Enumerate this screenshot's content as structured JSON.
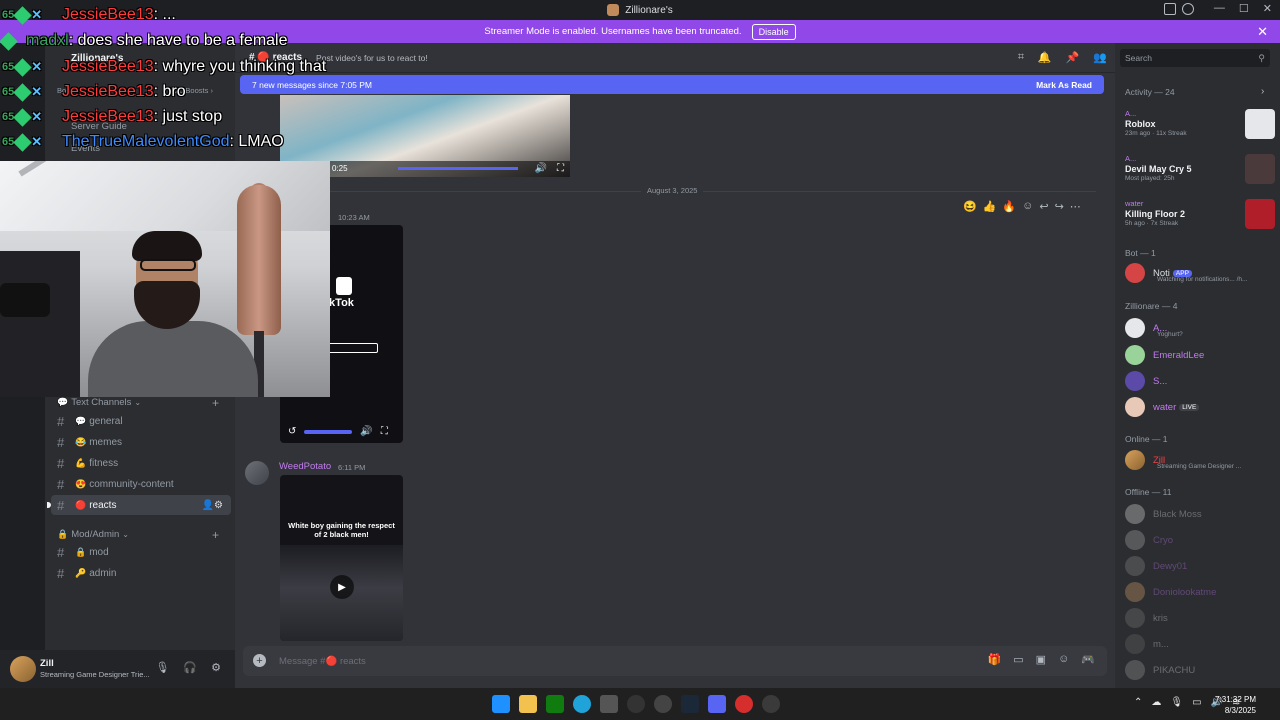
{
  "window": {
    "title": "Zillionare's",
    "controls": [
      "—",
      "☐",
      "✕"
    ]
  },
  "streamer_banner": {
    "text": "Streamer Mode is enabled. Usernames have been truncated.",
    "button": "Disable"
  },
  "sidebar": {
    "server_name": "Zillionare's",
    "boost_left": "Boost Goal",
    "boost_right": "20 Boosts ›",
    "server_guide": "Server Guide",
    "events": "Events",
    "text_category": "Text Channels",
    "mod_category": "Mod/Admin",
    "channels": [
      {
        "name": "general",
        "emoji": "💬"
      },
      {
        "name": "memes",
        "emoji": "😂"
      },
      {
        "name": "fitness",
        "emoji": "💪"
      },
      {
        "name": "community-content",
        "emoji": "😍"
      },
      {
        "name": "reacts",
        "emoji": "🔴"
      }
    ],
    "mod_channels": [
      {
        "name": "mod",
        "emoji": "🔒"
      },
      {
        "name": "admin",
        "emoji": "🔑"
      }
    ]
  },
  "user_panel": {
    "name": "Zill",
    "status": "Streaming Game Designer Trie..."
  },
  "chat": {
    "channel": "reacts",
    "topic": "Post video's for us to react to!",
    "new_messages": "7 new messages since 7:05 PM",
    "mark_as_read": "Mark As Read",
    "video1_time": "0:25",
    "date_divider": "August 3, 2025",
    "msg1_time": "10:23 AM",
    "tiktok_label": "ikTok",
    "author": "WeedPotato",
    "author_time": "6:11 PM",
    "video3_caption": "White boy gaining the respect of 2 black men!",
    "composer_placeholder": "Message #🔴 reacts"
  },
  "members": {
    "search_placeholder": "Search",
    "activity_header": "Activity — 24",
    "activities": [
      {
        "user": "A...",
        "game": "Roblox",
        "meta": "23m ago · 11x Streak",
        "color": "#e6e7ea"
      },
      {
        "user": "A...",
        "game": "Devil May Cry 5",
        "meta": "Most played: 25h",
        "color": "#4a3a3c"
      },
      {
        "user": "water",
        "game": "Killing Floor 2",
        "meta": "5h ago · 7x Streak",
        "color": "#b01e2a"
      }
    ],
    "bot_header": "Bot — 1",
    "bot": {
      "name": "Noti",
      "badge": "APP",
      "sub": "Watching for notifications... /h..."
    },
    "zill_header": "Zillionare — 4",
    "zill_members": [
      {
        "name": "A...",
        "sub": "Yoghurt?",
        "color": "#c27bf0"
      },
      {
        "name": "EmeraldLee",
        "sub": "",
        "color": "#c27bf0"
      },
      {
        "name": "S...",
        "sub": "",
        "color": "#c27bf0"
      },
      {
        "name": "water",
        "sub": "",
        "color": "#c27bf0",
        "badge": "LIVE"
      }
    ],
    "online_header": "Online — 1",
    "online_member": {
      "name": "Zill",
      "sub": "Streaming Game Designer ..."
    },
    "offline_header": "Offline — 11",
    "offline_members": [
      "Black Moss",
      "Cryo",
      "Dewy01",
      "Doniolookatme",
      "kris",
      "m...",
      "PIKACHU"
    ]
  },
  "overlay_chat": [
    {
      "user": "JessieBee13",
      "msg": "...",
      "color": "#ff3b3b"
    },
    {
      "user": "madxl",
      "msg": "does she have to be a female",
      "color": "#3ba55d"
    },
    {
      "user": "JessieBee13",
      "msg": "whyre you thinking that",
      "color": "#ff3b3b"
    },
    {
      "user": "JessieBee13",
      "msg": "bro",
      "color": "#ff3b3b"
    },
    {
      "user": "JessieBee13",
      "msg": "just stop",
      "color": "#ff3b3b"
    },
    {
      "user": "TheTrueMalevolentGod",
      "msg": "LMAO",
      "color": "#3d8bff"
    }
  ],
  "taskbar": {
    "time": "7:31:32 PM",
    "date": "8/3/2025"
  },
  "colors": {
    "accent": "#5865f2",
    "streamer_banner": "#9148e8"
  }
}
